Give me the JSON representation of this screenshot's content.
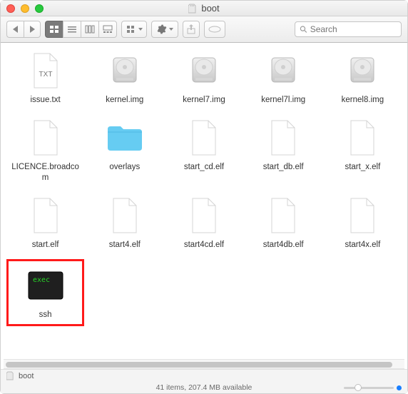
{
  "window": {
    "title": "boot"
  },
  "toolbar": {
    "search_placeholder": "Search"
  },
  "files": [
    {
      "name": "issue.txt",
      "kind": "txt"
    },
    {
      "name": "kernel.img",
      "kind": "img"
    },
    {
      "name": "kernel7.img",
      "kind": "img"
    },
    {
      "name": "kernel7l.img",
      "kind": "img"
    },
    {
      "name": "kernel8.img",
      "kind": "img"
    },
    {
      "name": "LICENCE.broadcom",
      "kind": "blank"
    },
    {
      "name": "overlays",
      "kind": "folder"
    },
    {
      "name": "start_cd.elf",
      "kind": "blank"
    },
    {
      "name": "start_db.elf",
      "kind": "blank"
    },
    {
      "name": "start_x.elf",
      "kind": "blank"
    },
    {
      "name": "start.elf",
      "kind": "blank"
    },
    {
      "name": "start4.elf",
      "kind": "blank"
    },
    {
      "name": "start4cd.elf",
      "kind": "blank"
    },
    {
      "name": "start4db.elf",
      "kind": "blank"
    },
    {
      "name": "start4x.elf",
      "kind": "blank"
    },
    {
      "name": "ssh",
      "kind": "exec",
      "highlight": true
    }
  ],
  "pathbar": {
    "location": "boot"
  },
  "status": {
    "text": "41 items, 207.4 MB available"
  },
  "icons": {
    "sd": "sd-card-icon",
    "back": "chevron-left-icon",
    "forward": "chevron-right-icon",
    "view_icon": "grid-view-icon",
    "view_list": "list-view-icon",
    "view_column": "column-view-icon",
    "view_gallery": "gallery-view-icon",
    "group": "group-by-icon",
    "action": "gear-icon",
    "share": "share-icon",
    "tags": "tag-icon",
    "search": "magnify-icon"
  }
}
